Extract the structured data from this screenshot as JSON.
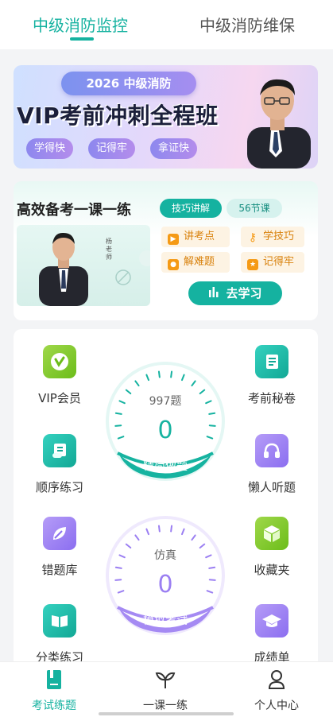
{
  "top_tabs": [
    {
      "label": "中级消防监控",
      "active": true
    },
    {
      "label": "中级消防维保",
      "active": false
    }
  ],
  "banner": {
    "pill": "2026 中级消防",
    "title": "VIP考前冲刺全程班",
    "chips": [
      "学得快",
      "记得牢",
      "拿证快"
    ]
  },
  "course": {
    "title": "高效备考一课一练",
    "badge_skill": "技巧讲解",
    "badge_count": "56节课",
    "teacher_tag": "杨老师",
    "features": [
      "讲考点",
      "学技巧",
      "解难题",
      "记得牢"
    ],
    "study_button": "去学习"
  },
  "tools": {
    "vip": "VIP会员",
    "secret": "考前秘卷",
    "sequence": "顺序练习",
    "listen": "懒人听题",
    "wrong": "错题库",
    "favorite": "收藏夹",
    "category": "分类练习",
    "score": "成绩单"
  },
  "dial_practice": {
    "count_label": "997题",
    "value": "0",
    "button": "精简做题"
  },
  "dial_exam": {
    "count_label": "仿真",
    "value": "0",
    "button": "模拟考试"
  },
  "bottom_nav": [
    {
      "label": "考试练题",
      "active": true,
      "icon": "notebook-icon"
    },
    {
      "label": "一课一练",
      "active": false,
      "icon": "sprout-icon"
    },
    {
      "label": "个人中心",
      "active": false,
      "icon": "person-icon"
    }
  ],
  "colors": {
    "accent": "#15b2a0",
    "purple": "#9b7ff2",
    "orange": "#f59a15"
  }
}
